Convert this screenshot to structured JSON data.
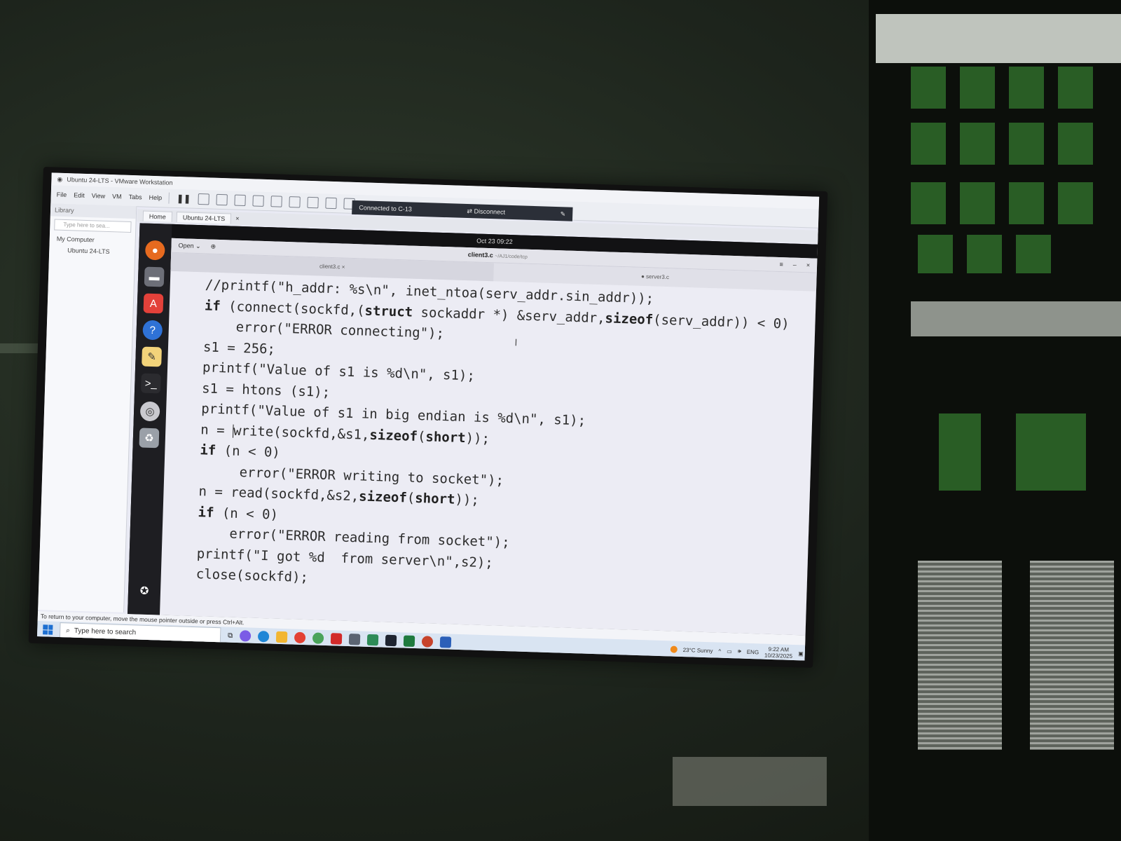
{
  "vmware": {
    "title": "Ubuntu 24-LTS - VMware Workstation",
    "menu": [
      "File",
      "Edit",
      "View",
      "VM",
      "Tabs",
      "Help"
    ],
    "connection_text": "Connected to C-13",
    "disconnect_label": "Disconnect",
    "library_label": "Library",
    "library_search_placeholder": "Type here to sea...",
    "tree_root": "My Computer",
    "tree_child": "Ubuntu 24-LTS",
    "tabs": [
      "Home",
      "Ubuntu 24-LTS"
    ],
    "status_text": "To return to your computer, move the mouse pointer outside or press Ctrl+Alt."
  },
  "guest": {
    "datetime": "Oct 23  09:22",
    "editor": {
      "open_label": "Open",
      "file_title": "client3.c",
      "file_path": "~/AJ1/code/tcp",
      "tabs": [
        "client3.c",
        "server3.c"
      ],
      "code_lines": [
        "//printf(\"h_addr: %s\\n\", inet_ntoa(serv_addr.sin_addr));",
        "if (connect(sockfd,(struct sockaddr *) &serv_addr,sizeof(serv_addr)) < 0)",
        "    error(\"ERROR connecting\");",
        "s1 = 256;",
        "printf(\"Value of s1 is %d\\n\", s1);",
        "s1 = htons (s1);",
        "printf(\"Value of s1 in big endian is %d\\n\", s1);",
        "n = write(sockfd,&s1,sizeof(short));",
        "if (n < 0)",
        "     error(\"ERROR writing to socket\");",
        "n = read(sockfd,&s2,sizeof(short));",
        "if (n < 0)",
        "    error(\"ERROR reading from socket\");",
        "printf(\"I got %d  from server\\n\",s2);",
        "close(sockfd);"
      ]
    }
  },
  "taskbar": {
    "search_placeholder": "Type here to search",
    "weather": "23°C  Sunny",
    "language": "ENG",
    "time": "9:22 AM",
    "date": "10/23/2025"
  },
  "colors": {
    "desktop_accent": "#1d6fd1",
    "editor_bg": "#ececf4",
    "gnome_bar": "#121214"
  }
}
